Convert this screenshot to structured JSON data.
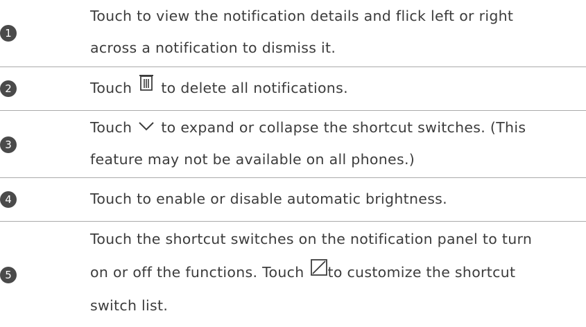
{
  "items": [
    {
      "number": "1",
      "lines": [
        "Touch to view the notification details and flick left or right",
        "across a notification to dismiss it."
      ]
    },
    {
      "number": "2",
      "before": "Touch",
      "after": "to delete all notifications.",
      "icon": "trash-icon"
    },
    {
      "number": "3",
      "before": "Touch",
      "after": "to expand or collapse the shortcut switches. (This",
      "line2": "feature may not be available on all phones.)",
      "icon": "chevron-down-icon"
    },
    {
      "number": "4",
      "lines": [
        "Touch to enable or disable automatic brightness."
      ]
    },
    {
      "number": "5",
      "line1": "Touch the shortcut switches on the notification panel to turn",
      "line2_before": "on or off the functions. Touch",
      "line2_after": "to customize the shortcut",
      "line3": "switch list.",
      "icon": "edit-icon"
    }
  ],
  "colors": {
    "text": "#3c3c3c",
    "badge": "#4a4a4a",
    "divider": "#a9a9a9"
  }
}
